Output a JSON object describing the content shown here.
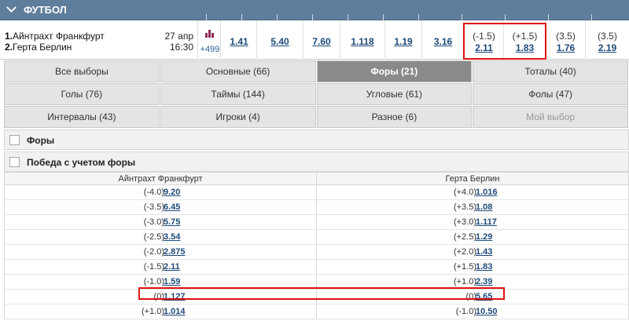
{
  "header": {
    "sport": "ФУТБОЛ"
  },
  "match": {
    "team1_num": "1.",
    "team1": "Айнтрахт Франкфурт",
    "team2_num": "2.",
    "team2": "Герта Берлин",
    "date": "27 апр",
    "time": "16:30",
    "more_markets": "+499",
    "odds": [
      "1.41",
      "5.40",
      "7.60",
      "1.118",
      "1.19",
      "3.16"
    ],
    "handicaps": [
      {
        "h": "(-1.5)",
        "v": "2.11"
      },
      {
        "h": "(+1.5)",
        "v": "1.83"
      },
      {
        "h": "(3.5)",
        "v": "1.76"
      },
      {
        "h": "(3.5)",
        "v": "2.19"
      }
    ]
  },
  "tabs": [
    [
      "Все выборы",
      "Основные (66)",
      "Форы (21)",
      "Тоталы (40)"
    ],
    [
      "Голы (76)",
      "Таймы (144)",
      "Угловые (61)",
      "Фолы (47)"
    ],
    [
      "Интервалы (43)",
      "Игроки (4)",
      "Разное (6)",
      "Мой выбор"
    ]
  ],
  "sections": {
    "handicaps": "Форы",
    "win_with_handicap": "Победа с учетом форы"
  },
  "table": {
    "col1": "Айнтрахт Франкфурт",
    "col2": "Герта Берлин",
    "rows": [
      {
        "h1": "(-4.0)",
        "o1": "9.20",
        "h2": "(+4.0)",
        "o2": "1.016"
      },
      {
        "h1": "(-3.5)",
        "o1": "6.45",
        "h2": "(+3.5)",
        "o2": "1.08"
      },
      {
        "h1": "(-3.0)",
        "o1": "5.75",
        "h2": "(+3.0)",
        "o2": "1.117"
      },
      {
        "h1": "(-2.5)",
        "o1": "3.54",
        "h2": "(+2.5)",
        "o2": "1.29"
      },
      {
        "h1": "(-2.0)",
        "o1": "2.875",
        "h2": "(+2.0)",
        "o2": "1.43"
      },
      {
        "h1": "(-1.5)",
        "o1": "2.11",
        "h2": "(+1.5)",
        "o2": "1.83"
      },
      {
        "h1": "(-1.0)",
        "o1": "1.59",
        "h2": "(+1.0)",
        "o2": "2.39"
      },
      {
        "h1": "(0)",
        "o1": "1.127",
        "h2": "(0)",
        "o2": "5.65"
      },
      {
        "h1": "(+1.0)",
        "o1": "1.014",
        "h2": "(-1.0)",
        "o2": "10.50"
      }
    ]
  },
  "colors": {
    "header_bg": "#5f7d9c",
    "link": "#1e4a7a",
    "active_tab": "#8a8a8a",
    "highlight": "#e01010"
  }
}
